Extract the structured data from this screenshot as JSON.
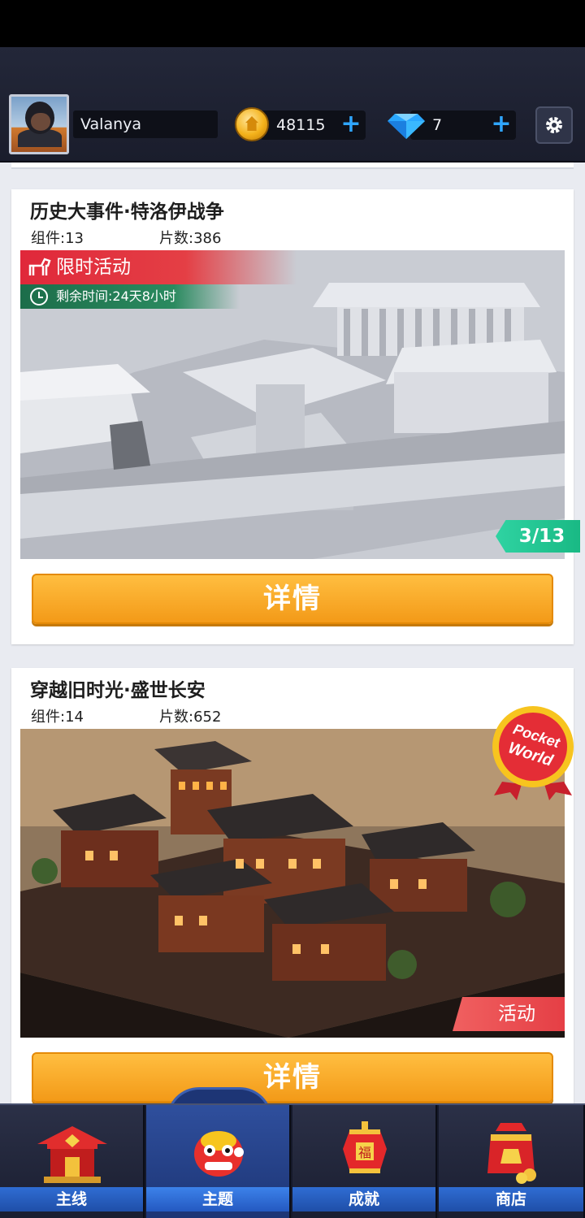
{
  "header": {
    "username": "Valanya",
    "coins": "48115",
    "gems": "7"
  },
  "icons": {
    "avatar": "avatar",
    "coin": "coin-icon",
    "gem": "diamond-icon",
    "settings": "gear-icon"
  },
  "themes": [
    {
      "title": "历史大事件·特洛伊战争",
      "components": "组件:13",
      "pieces": "片数:386",
      "limited_label": "限时活动",
      "time_left": "剩余时间:24天8小时",
      "progress": "3/13",
      "button": "详情"
    },
    {
      "title": "穿越旧时光·盛世长安",
      "components": "组件:14",
      "pieces": "片数:652",
      "event_tag": "活动",
      "badge_line1": "Pocket",
      "badge_line2": "World",
      "button": "详情"
    }
  ],
  "nav": {
    "tabs": [
      {
        "label": "主线",
        "icon": "pagoda-icon"
      },
      {
        "label": "主题",
        "icon": "lion-head-icon"
      },
      {
        "label": "成就",
        "icon": "fu-lantern-icon"
      },
      {
        "label": "商店",
        "icon": "shop-bag-icon"
      }
    ],
    "active_index": 1
  },
  "colors": {
    "accent_orange": "#f39a18",
    "nav_blue": "#2f6dd3",
    "limited_red": "#e0283a",
    "time_green": "#1c6d4a",
    "progress_teal": "#2fd3a2"
  }
}
